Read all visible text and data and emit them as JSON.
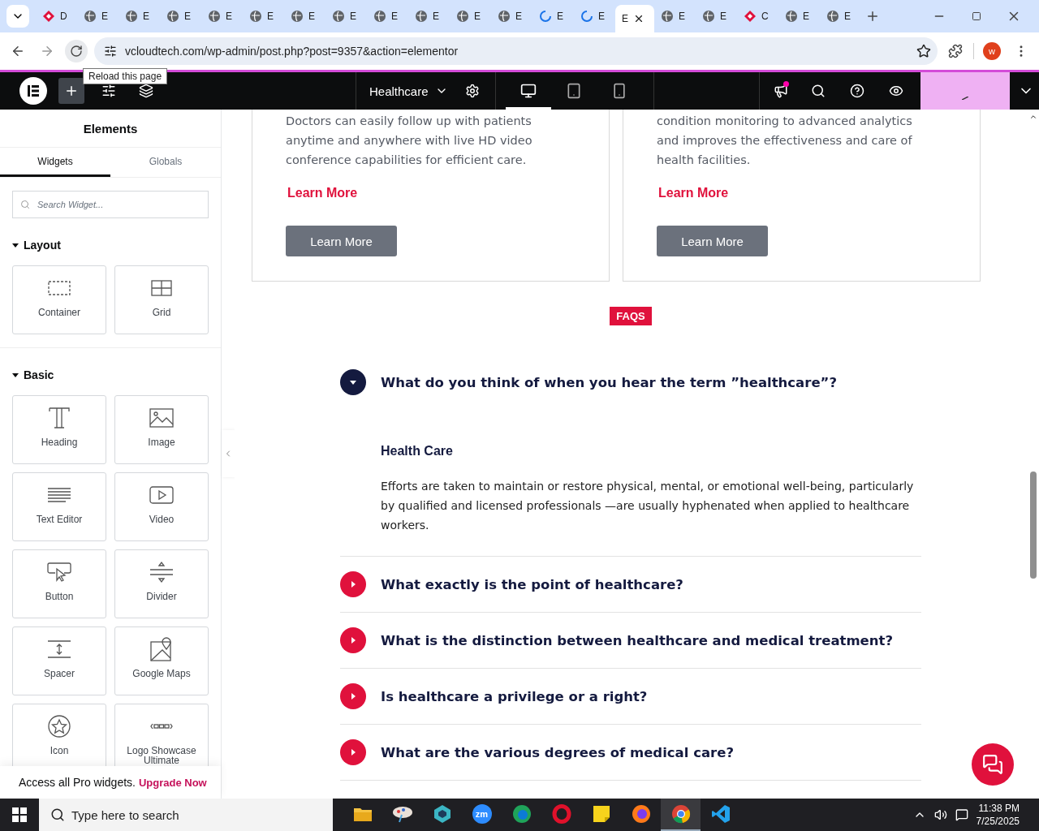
{
  "browser": {
    "tabs": [
      {
        "label": "D",
        "kind": "gem",
        "selected": false
      },
      {
        "label": "E",
        "kind": "globe",
        "selected": false
      },
      {
        "label": "E",
        "kind": "globe",
        "selected": false
      },
      {
        "label": "E",
        "kind": "globe",
        "selected": false
      },
      {
        "label": "E",
        "kind": "globe",
        "selected": false
      },
      {
        "label": "E",
        "kind": "globe",
        "selected": false
      },
      {
        "label": "E",
        "kind": "globe",
        "selected": false
      },
      {
        "label": "E",
        "kind": "globe",
        "selected": false
      },
      {
        "label": "E",
        "kind": "globe",
        "selected": false
      },
      {
        "label": "E",
        "kind": "globe",
        "selected": false
      },
      {
        "label": "E",
        "kind": "globe",
        "selected": false
      },
      {
        "label": "E",
        "kind": "globe",
        "selected": false
      },
      {
        "label": "E",
        "kind": "loading",
        "selected": false
      },
      {
        "label": "E",
        "kind": "loading",
        "selected": false
      },
      {
        "label": "E",
        "kind": "none",
        "selected": true
      },
      {
        "label": "E",
        "kind": "globe",
        "selected": false
      },
      {
        "label": "E",
        "kind": "globe",
        "selected": false
      },
      {
        "label": "C",
        "kind": "gem",
        "selected": false
      },
      {
        "label": "E",
        "kind": "globe",
        "selected": false
      },
      {
        "label": "E",
        "kind": "globe",
        "selected": false
      }
    ],
    "url": "vcloudtech.com/wp-admin/post.php?post=9357&action=elementor",
    "tooltip": "Reload this page",
    "profile": "w"
  },
  "editor_bar": {
    "page_title": "Healthcare",
    "devices": [
      {
        "kind": "desktop",
        "selected": true
      },
      {
        "kind": "tablet",
        "selected": false
      },
      {
        "kind": "mobile",
        "selected": false
      }
    ]
  },
  "panel": {
    "title": "Elements",
    "tabs": [
      {
        "label": "Widgets",
        "selected": true
      },
      {
        "label": "Globals",
        "selected": false
      }
    ],
    "search": {
      "placeholder": "Search Widget..."
    },
    "sections": [
      {
        "title": "Layout",
        "expanded": true,
        "widgets": [
          {
            "label": "Container",
            "kind": "container"
          },
          {
            "label": "Grid",
            "kind": "grid"
          }
        ]
      },
      {
        "title": "Basic",
        "expanded": true,
        "widgets": [
          {
            "label": "Heading",
            "kind": "heading"
          },
          {
            "label": "Image",
            "kind": "image"
          },
          {
            "label": "Text Editor",
            "kind": "text"
          },
          {
            "label": "Video",
            "kind": "video"
          },
          {
            "label": "Button",
            "kind": "button"
          },
          {
            "label": "Divider",
            "kind": "divider"
          },
          {
            "label": "Spacer",
            "kind": "spacer"
          },
          {
            "label": "Google Maps",
            "kind": "map"
          },
          {
            "label": "Icon",
            "kind": "star"
          },
          {
            "label": "Logo Showcase Ultimate",
            "kind": "logos"
          }
        ]
      }
    ],
    "promo": {
      "text": "Access all Pro widgets.",
      "link": "Upgrade Now"
    }
  },
  "canvas": {
    "cards": [
      {
        "text": "Doctors can easily follow up with patients anytime and anywhere with live HD video conference capabilities for efficient care.",
        "link": "Learn More",
        "button": "Learn More"
      },
      {
        "text": "condition monitoring to advanced analytics and improves the effectiveness and care of health facilities.",
        "link": "Learn More",
        "button": "Learn More"
      }
    ],
    "badge": "FAQS",
    "faqs": [
      {
        "question": "What do you think of when you hear the term ”healthcare”?",
        "expanded": true,
        "answer_title": "Health Care",
        "answer": "Efforts are taken to maintain or restore physical, mental, or emotional well-being, particularly by qualified and licensed professionals —are usually hyphenated when applied to healthcare workers."
      },
      {
        "question": "What exactly is the point of healthcare?",
        "expanded": false
      },
      {
        "question": "What is the distinction between healthcare and medical treatment?",
        "expanded": false
      },
      {
        "question": "Is healthcare a privilege or a right?",
        "expanded": false
      },
      {
        "question": "What are the various degrees of medical care?",
        "expanded": false
      }
    ]
  },
  "taskbar": {
    "search_placeholder": "Type here to search",
    "apps": [
      {
        "kind": "folder"
      },
      {
        "kind": "paint"
      },
      {
        "kind": "hex"
      },
      {
        "kind": "zoom",
        "label": "zm"
      },
      {
        "kind": "edge"
      },
      {
        "kind": "opera"
      },
      {
        "kind": "notes"
      },
      {
        "kind": "firefox"
      },
      {
        "kind": "chrome",
        "selected": true
      },
      {
        "kind": "vscode"
      }
    ],
    "time": "11:38 PM",
    "date": "7/25/2025"
  }
}
